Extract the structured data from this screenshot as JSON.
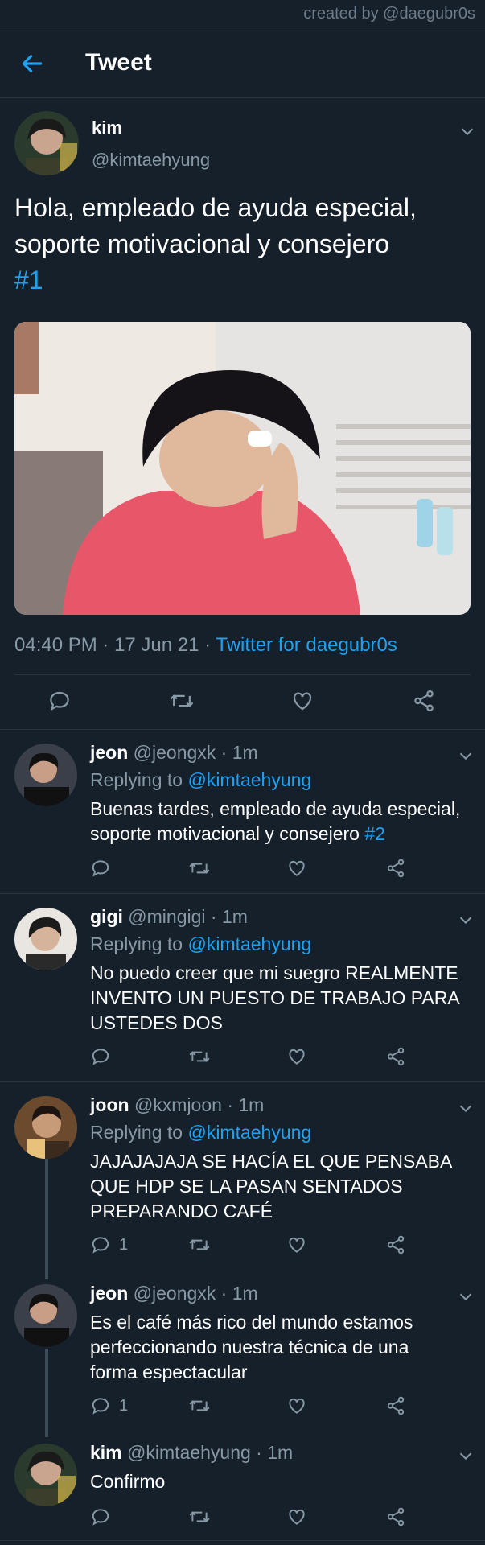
{
  "credit": "created by @daegubr0s",
  "header": {
    "title": "Tweet"
  },
  "main_tweet": {
    "name": "kim",
    "handle": "@kimtaehyung",
    "text_line1": "Hola, empleado de ayuda especial,",
    "text_line2": " soporte motivacional y consejero",
    "hashtag": "#1",
    "time": "04:40 PM · 17 Jun 21 · ",
    "source": "Twitter for daegubr0s"
  },
  "replies": [
    {
      "name": "jeon",
      "handle": "@jeongxk · 1m",
      "replying_prefix": "Replying to ",
      "replying_to": "@kimtaehyung",
      "text_line1": "Buenas tardes, empleado de ayuda especial,",
      "text_line2": " soporte motivacional y consejero ",
      "hashtag": "#2"
    },
    {
      "name": "gigi",
      "handle": "@mingigi · 1m",
      "replying_prefix": "Replying to ",
      "replying_to": "@kimtaehyung",
      "text_line1": "No puedo creer que mi suegro REALMENTE",
      "text_line2": "INVENTO UN PUESTO DE TRABAJO PARA",
      "text_line3": "USTEDES DOS"
    },
    {
      "name": "joon",
      "handle": "@kxmjoon · 1m",
      "replying_prefix": "Replying to ",
      "replying_to": "@kimtaehyung",
      "text_line1": "JAJAJAJAJA SE HACÍA EL QUE PENSABA",
      "text_line2": "QUE HDP SE LA PASAN SENTADOS",
      "text_line3": "PREPARANDO CAFÉ",
      "reply_count": "1"
    },
    {
      "name": "jeon",
      "handle": "@jeongxk · 1m",
      "text_line1": "Es el café más rico del mundo estamos",
      "text_line2": "perfeccionando nuestra técnica de una",
      "text_line3": "forma espectacular",
      "reply_count": "1"
    },
    {
      "name": "kim",
      "handle": "@kimtaehyung · 1m",
      "text_line1": "Confirmo"
    }
  ],
  "icons": [
    "back-arrow-icon",
    "chevron-down-icon",
    "reply-icon",
    "retweet-icon",
    "like-icon",
    "share-icon"
  ],
  "colors": {
    "background": "#15202b",
    "accent": "#1da1f2",
    "muted": "#8899a6",
    "divider": "#2b3640"
  }
}
